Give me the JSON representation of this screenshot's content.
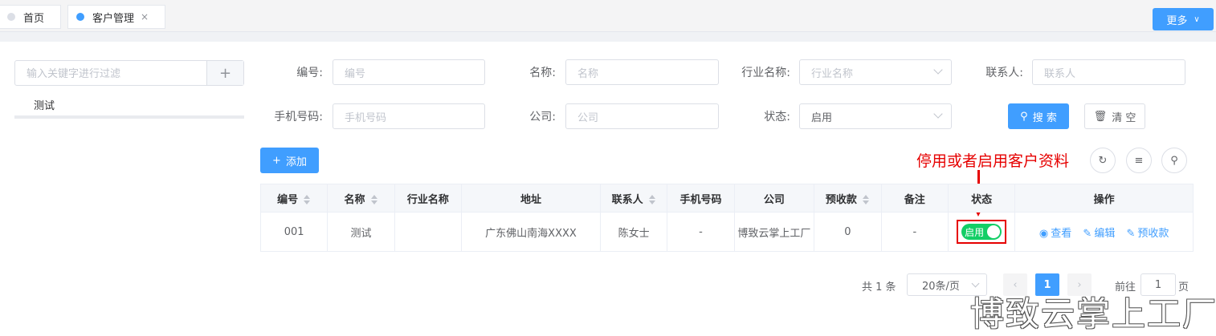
{
  "tabs": {
    "home": "首页",
    "customer": "客户管理",
    "close": "×",
    "more": "更多"
  },
  "sidebar": {
    "filter_placeholder": "输入关键字进行过滤",
    "add": "+",
    "tree_items": [
      "测试"
    ]
  },
  "form": {
    "code_label": "编号:",
    "code_placeholder": "编号",
    "name_label": "名称:",
    "name_placeholder": "名称",
    "industry_label": "行业名称:",
    "industry_placeholder": "行业名称",
    "contact_label": "联系人:",
    "contact_placeholder": "联系人",
    "phone_label": "手机号码:",
    "phone_placeholder": "手机号码",
    "company_label": "公司:",
    "company_placeholder": "公司",
    "status_label": "状态:",
    "status_value": "启用",
    "search": "搜 索",
    "clear": "清 空"
  },
  "toolbar": {
    "add": "添加"
  },
  "annotation": "停用或者启用客户资料",
  "table": {
    "headers": [
      "编号",
      "名称",
      "行业名称",
      "地址",
      "联系人",
      "手机号码",
      "公司",
      "预收款",
      "备注",
      "状态",
      "操作"
    ],
    "rows": [
      {
        "code": "001",
        "name": "测试",
        "industry": "",
        "address": "广东佛山南海XXXX",
        "contact": "陈女士",
        "phone": "-",
        "company": "博致云掌上工厂",
        "prepayment": "0",
        "remark": "-",
        "status": "启用",
        "ops": [
          "查看",
          "编辑",
          "预收款"
        ]
      }
    ]
  },
  "pagination": {
    "total": "共 1 条",
    "page_size": "20条/页",
    "current": "1",
    "goto": "前往",
    "goto_value": "1",
    "page_suffix": "页"
  },
  "watermark": "博致云掌上工厂",
  "colors": {
    "primary": "#409eff",
    "switch_on": "#13ce66",
    "annotation": "#e60000"
  }
}
